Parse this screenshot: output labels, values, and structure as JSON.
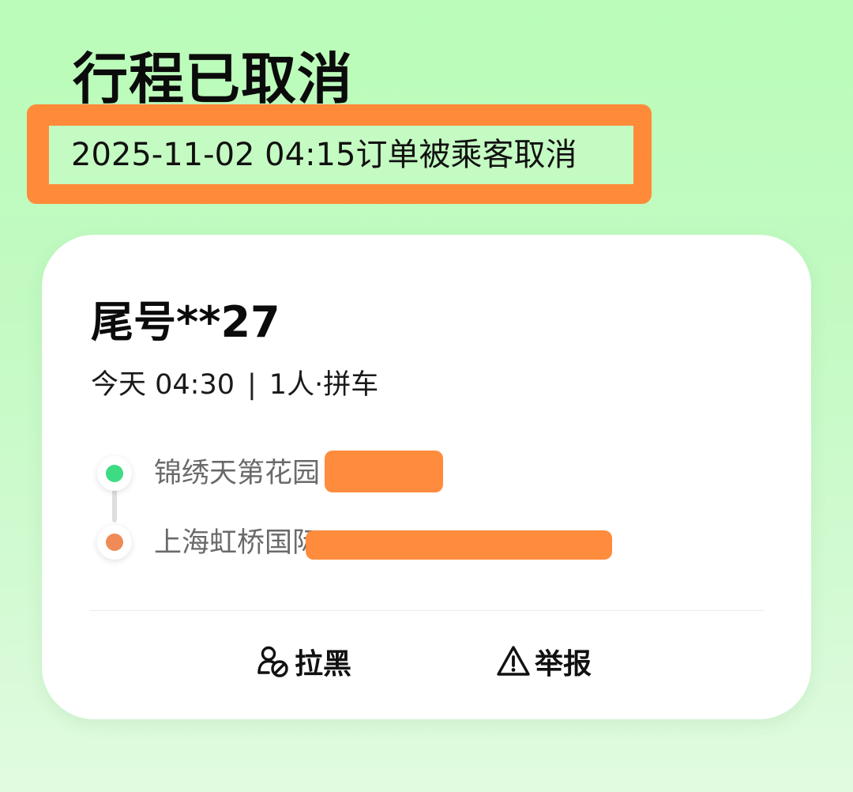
{
  "header": {
    "title": "行程已取消",
    "cancel_info": "2025-11-02 04:15订单被乘客取消"
  },
  "trip": {
    "passenger": "尾号**27",
    "time": "今天 04:30",
    "separator": "|",
    "details": "1人·拼车",
    "origin": "锦绣天第花园",
    "destination": "上海虹桥国际"
  },
  "actions": {
    "block_label": "拉黑",
    "report_label": "举报"
  },
  "colors": {
    "origin_dot": "#3ddc84",
    "destination_dot": "#f08a56",
    "highlight": "#ff8b3a"
  }
}
